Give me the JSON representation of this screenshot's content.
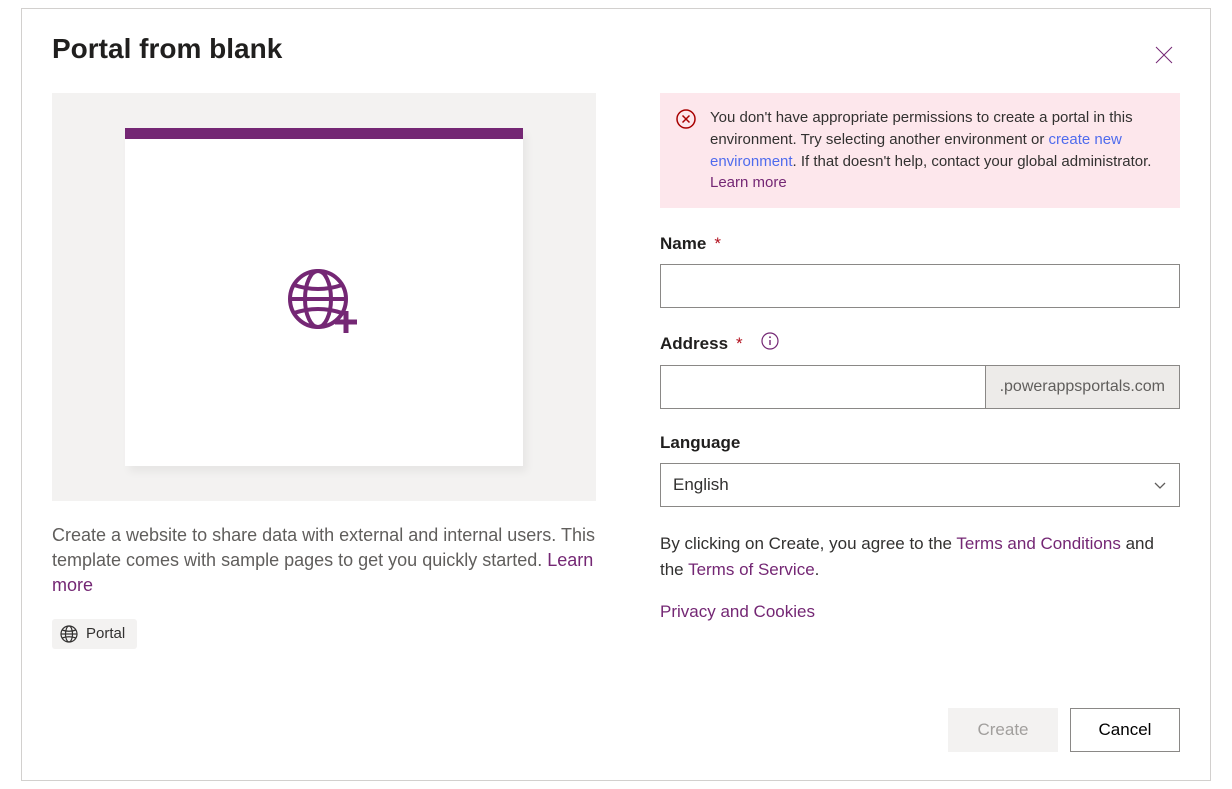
{
  "title": "Portal from blank",
  "description": {
    "text": "Create a website to share data with external and internal users. This template comes with sample pages to get you quickly started. ",
    "learn_more": "Learn more"
  },
  "badge": {
    "label": "Portal"
  },
  "error": {
    "text_before": "You don't have appropriate permissions to create a portal in this environment. Try selecting another environment or ",
    "link": "create new environment",
    "text_mid": ". If that doesn't help, contact your global administrator. ",
    "learn_more": "Learn more"
  },
  "form": {
    "name": {
      "label": "Name",
      "value": ""
    },
    "address": {
      "label": "Address",
      "value": "",
      "suffix": ".powerappsportals.com"
    },
    "language": {
      "label": "Language",
      "value": "English"
    }
  },
  "agree": {
    "text_before": "By clicking on Create, you agree to the ",
    "terms": "Terms and Conditions",
    "text_mid": " and the ",
    "tos": "Terms of Service",
    "text_after": "."
  },
  "privacy": "Privacy and Cookies",
  "buttons": {
    "create": "Create",
    "cancel": "Cancel"
  }
}
